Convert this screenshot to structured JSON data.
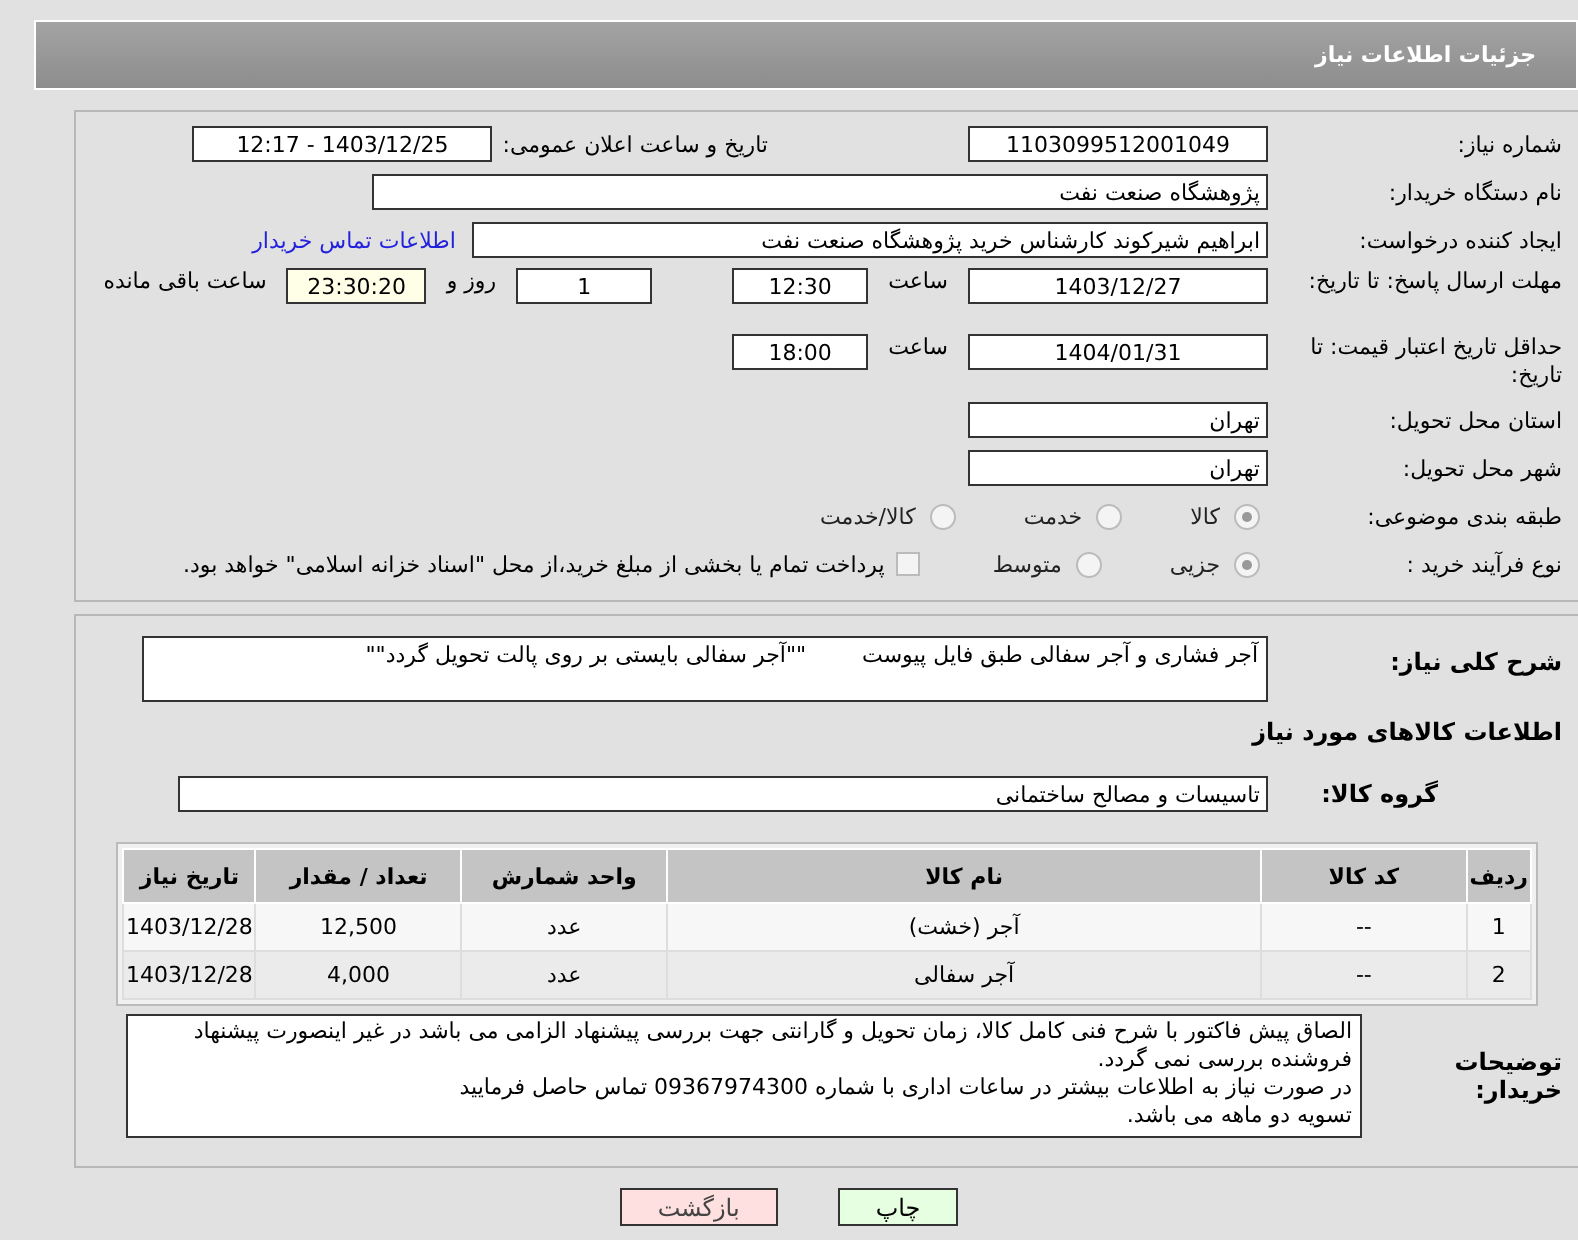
{
  "header": {
    "title": "جزئیات اطلاعات نیاز"
  },
  "details": {
    "need_number": {
      "label": "شماره نیاز:",
      "value": "1103099512001049"
    },
    "announce": {
      "label": "تاریخ و ساعت اعلان عمومی:",
      "value": "1403/12/25 - 12:17"
    },
    "buyer": {
      "label": "نام دستگاه خریدار:",
      "value": "پژوهشگاه صنعت نفت"
    },
    "creator": {
      "label": "ایجاد کننده درخواست:",
      "value": "ابراهیم شیرکوند کارشناس خرید پژوهشگاه صنعت نفت",
      "link": "اطلاعات تماس خریدار"
    },
    "deadline": {
      "label": "مهلت ارسال پاسخ: تا تاریخ:",
      "date": "1403/12/27",
      "time_label": "ساعت",
      "time": "12:30",
      "days": "1",
      "days_label": "روز و",
      "remaining": "23:30:20",
      "remaining_label": "ساعت باقی مانده"
    },
    "validity": {
      "label": "حداقل تاریخ اعتبار قیمت: تا تاریخ:",
      "date": "1404/01/31",
      "time_label": "ساعت",
      "time": "18:00"
    },
    "province": {
      "label": "استان محل تحویل:",
      "value": "تهران"
    },
    "city": {
      "label": "شهر محل تحویل:",
      "value": "تهران"
    },
    "category": {
      "label": "طبقه بندی موضوعی:",
      "options": [
        {
          "label": "کالا",
          "selected": true
        },
        {
          "label": "خدمت",
          "selected": false
        },
        {
          "label": "کالا/خدمت",
          "selected": false
        }
      ]
    },
    "process": {
      "label": "نوع فرآیند خرید :",
      "options": [
        {
          "label": "جزیی",
          "selected": true
        },
        {
          "label": "متوسط",
          "selected": false
        }
      ],
      "treasury": {
        "label": "پرداخت تمام یا بخشی از مبلغ خرید،از محل \"اسناد خزانه اسلامی\" خواهد بود.",
        "checked": false
      }
    }
  },
  "needs": {
    "summary": {
      "label": "شرح کلی نیاز:",
      "value": "آجر فشاری و آجر سفالی طبق فایل پیوست        \"\"آجر سفالی بایستی بر روی پالت تحویل گردد\"\""
    },
    "heading": "اطلاعات کالاهای مورد نیاز",
    "group": {
      "label": "گروه کالا:",
      "value": "تاسیسات و مصالح ساختمانی"
    },
    "table": {
      "columns": [
        "ردیف",
        "کد کالا",
        "نام کالا",
        "واحد شمارش",
        "تعداد / مقدار",
        "تاریخ نیاز"
      ],
      "rows": [
        [
          "1",
          "--",
          "آجر (خشت)",
          "عدد",
          "12,500",
          "1403/12/28"
        ],
        [
          "2",
          "--",
          "آجر سفالی",
          "عدد",
          "4,000",
          "1403/12/28"
        ]
      ]
    },
    "buyer_notes": {
      "label": "توضیحات خریدار:",
      "lines": [
        "الصاق پیش فاکتور با شرح فنی کامل کالا، زمان تحویل و گارانتی جهت بررسی پیشنهاد الزامی می باشد در غیر اینصورت پیشنهاد فروشنده بررسی نمی گردد.",
        "در صورت نیاز به اطلاعات بیشتر در ساعات اداری با شماره 09367974300 تماس حاصل فرمایید",
        "تسویه دو ماهه می باشد."
      ]
    }
  },
  "buttons": [
    {
      "label": "چاپ",
      "kind": "print"
    },
    {
      "label": "بازگشت",
      "kind": "back"
    }
  ]
}
